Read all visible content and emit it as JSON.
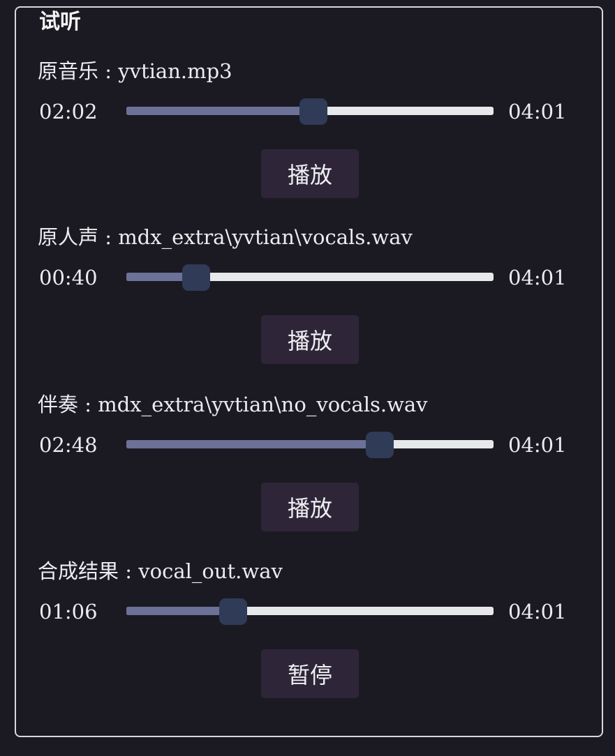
{
  "group_title": "试听",
  "tracks": [
    {
      "label": "原音乐",
      "sep": " : ",
      "file": "yvtian.mp3",
      "current": "02:02",
      "total": "04:01",
      "progress": 0.51,
      "button": "播放"
    },
    {
      "label": "原人声",
      "sep": " : ",
      "file": "mdx_extra\\yvtian\\vocals.wav",
      "current": "00:40",
      "total": "04:01",
      "progress": 0.19,
      "button": "播放"
    },
    {
      "label": "伴奏",
      "sep": " : ",
      "file": "mdx_extra\\yvtian\\no_vocals.wav",
      "current": "02:48",
      "total": "04:01",
      "progress": 0.69,
      "button": "播放"
    },
    {
      "label": "合成结果",
      "sep": " : ",
      "file": "vocal_out.wav",
      "current": "01:06",
      "total": "04:01",
      "progress": 0.29,
      "button": "暂停"
    }
  ],
  "colors": {
    "background": "#1b1a22",
    "groove": "#e6e8ea",
    "fill": "#6c7197",
    "handle": "#303b58",
    "button": "#2e2638"
  }
}
